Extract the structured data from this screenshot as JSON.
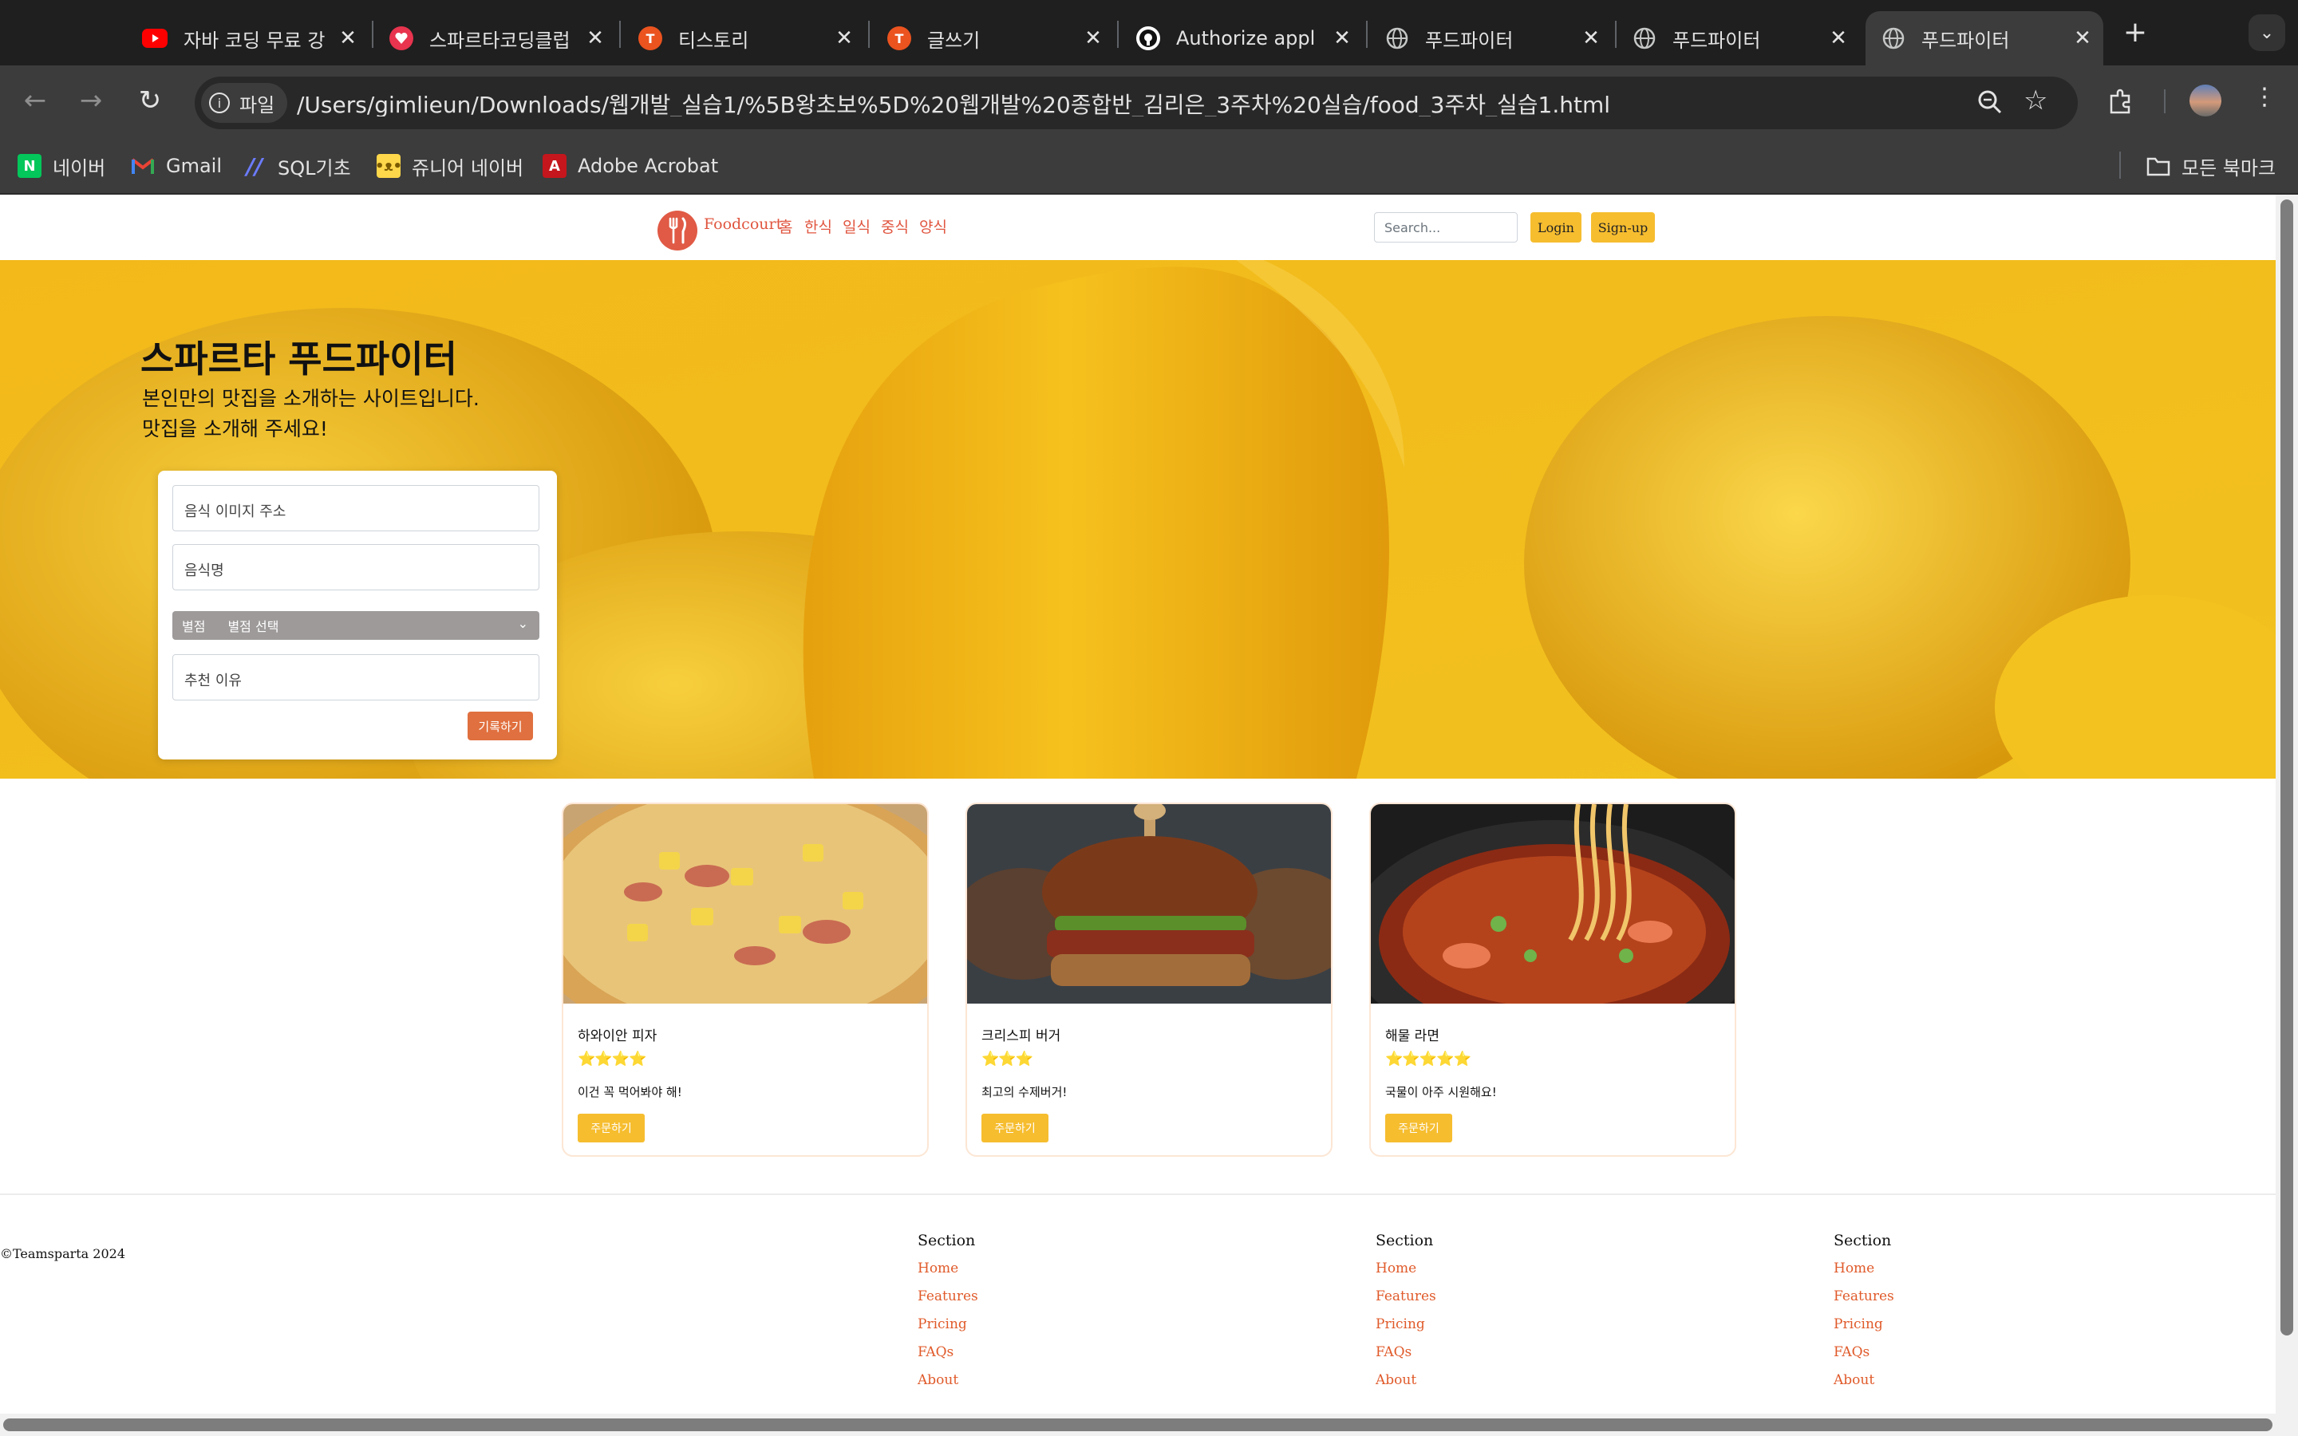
{
  "browser": {
    "tabs": [
      {
        "title": "자바 코딩 무료 강",
        "favicon": "youtube-icon"
      },
      {
        "title": "스파르타코딩클럽",
        "favicon": "sparta-icon"
      },
      {
        "title": "티스토리",
        "favicon": "tistory-icon"
      },
      {
        "title": "글쓰기",
        "favicon": "tistory-icon"
      },
      {
        "title": "Authorize appl",
        "favicon": "github-icon"
      },
      {
        "title": "푸드파이터",
        "favicon": "globe-icon"
      },
      {
        "title": "푸드파이터",
        "favicon": "globe-icon"
      },
      {
        "title": "푸드파이터",
        "favicon": "globe-icon"
      }
    ],
    "address_badge": "파일",
    "url": "/Users/gimlieun/Downloads/웹개발_실습1/%5B왕초보%5D%20웹개발%20종합반_김리은_3주차%20실습/food_3주차_실습1.html",
    "bookmarks": [
      "네이버",
      "Gmail",
      "SQL기초",
      "쥬니어 네이버",
      "Adobe Acrobat"
    ],
    "all_bookmarks": "모든 북마크"
  },
  "page": {
    "header": {
      "brand": "Foodcourt",
      "nav": [
        "홈",
        "한식",
        "일식",
        "중식",
        "양식"
      ],
      "search_placeholder": "Search...",
      "login": "Login",
      "signup": "Sign-up"
    },
    "hero": {
      "title": "스파르타 푸드파이터",
      "line1": "본인만의 맛집을 소개하는 사이트입니다.",
      "line2": "맛집을 소개해 주세요!"
    },
    "form": {
      "image_placeholder": "음식 이미지 주소",
      "name_placeholder": "음식명",
      "rating_label": "별점",
      "rating_select": "별점 선택",
      "reason_placeholder": "추천 이유",
      "submit": "기록하기"
    },
    "cards": [
      {
        "title": "하와이안 피자",
        "stars": 4,
        "comment": "이건 꼭 먹어봐야 해!",
        "button": "주문하기"
      },
      {
        "title": "크리스피 버거",
        "stars": 3,
        "comment": "최고의 수제버거!",
        "button": "주문하기"
      },
      {
        "title": "해물 라면",
        "stars": 5,
        "comment": "국물이 아주 시원해요!",
        "button": "주문하기"
      }
    ],
    "footer": {
      "copyright": "©Teamsparta 2024",
      "sections": [
        {
          "heading": "Section",
          "links": [
            "Home",
            "Features",
            "Pricing",
            "FAQs",
            "About"
          ]
        },
        {
          "heading": "Section",
          "links": [
            "Home",
            "Features",
            "Pricing",
            "FAQs",
            "About"
          ]
        },
        {
          "heading": "Section",
          "links": [
            "Home",
            "Features",
            "Pricing",
            "FAQs",
            "About"
          ]
        }
      ]
    }
  },
  "colors": {
    "accent": "#e0553f",
    "yellow_button": "#f6bd2f",
    "hero_background": "#f0b81c",
    "star": "#f3c31b"
  }
}
